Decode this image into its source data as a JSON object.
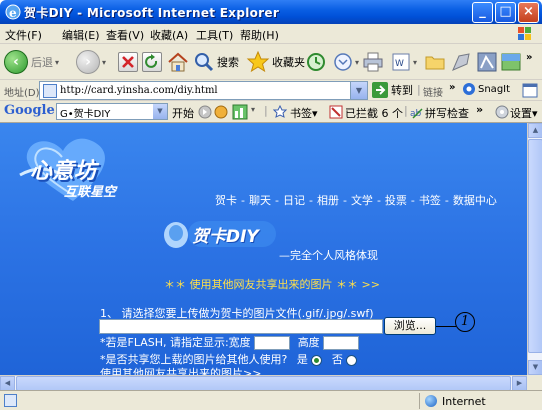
{
  "window": {
    "title": "贺卡DIY - Microsoft Internet Explorer",
    "minimize": "_",
    "maximize": "□",
    "close": "×"
  },
  "menu": [
    "文件(F)",
    "编辑(E)",
    "查看(V)",
    "收藏(A)",
    "工具(T)",
    "帮助(H)"
  ],
  "toolbar": {
    "back": "后退",
    "search": "搜索",
    "favorites": "收藏夹"
  },
  "address": {
    "label": "地址(D)",
    "url": "http://card.yinsha.com/diy.html",
    "go": "转到",
    "links": "链接",
    "snagit": "SnagIt"
  },
  "google": {
    "logo": "Google",
    "search_value": "G•贺卡DIY",
    "start": "开始",
    "bookmarks": "书签▾",
    "blocked": "已拦截 6 个",
    "spellcheck": "拼写检查",
    "settings": "设置▾"
  },
  "page": {
    "logo_main": "心意坊",
    "logo_sub": "互联星空",
    "nav": [
      "贺卡",
      "聊天",
      "日记",
      "相册",
      "文学",
      "投票",
      "书签",
      "数据中心"
    ],
    "nav_sep": "-",
    "card_logo": "贺卡DIY",
    "slogan": "—完全个人风格体现",
    "share_link": "＊＊ 使用其他网友共享出来的图片 ＊＊ >>",
    "step1": "1、 请选择您要上传做为贺卡的图片文件(.gif/.jpg/.swf)",
    "browse": "浏览...",
    "callout": "1",
    "flash_label": "*若是FLASH, 请指定显示:宽度",
    "height_label": "高度",
    "share_label": "*是否共享您上载的图片给其他人使用?",
    "yes": "是",
    "no": "否",
    "other": "使用其他网友共享出来的图片>>"
  },
  "status": {
    "zone": "Internet"
  }
}
